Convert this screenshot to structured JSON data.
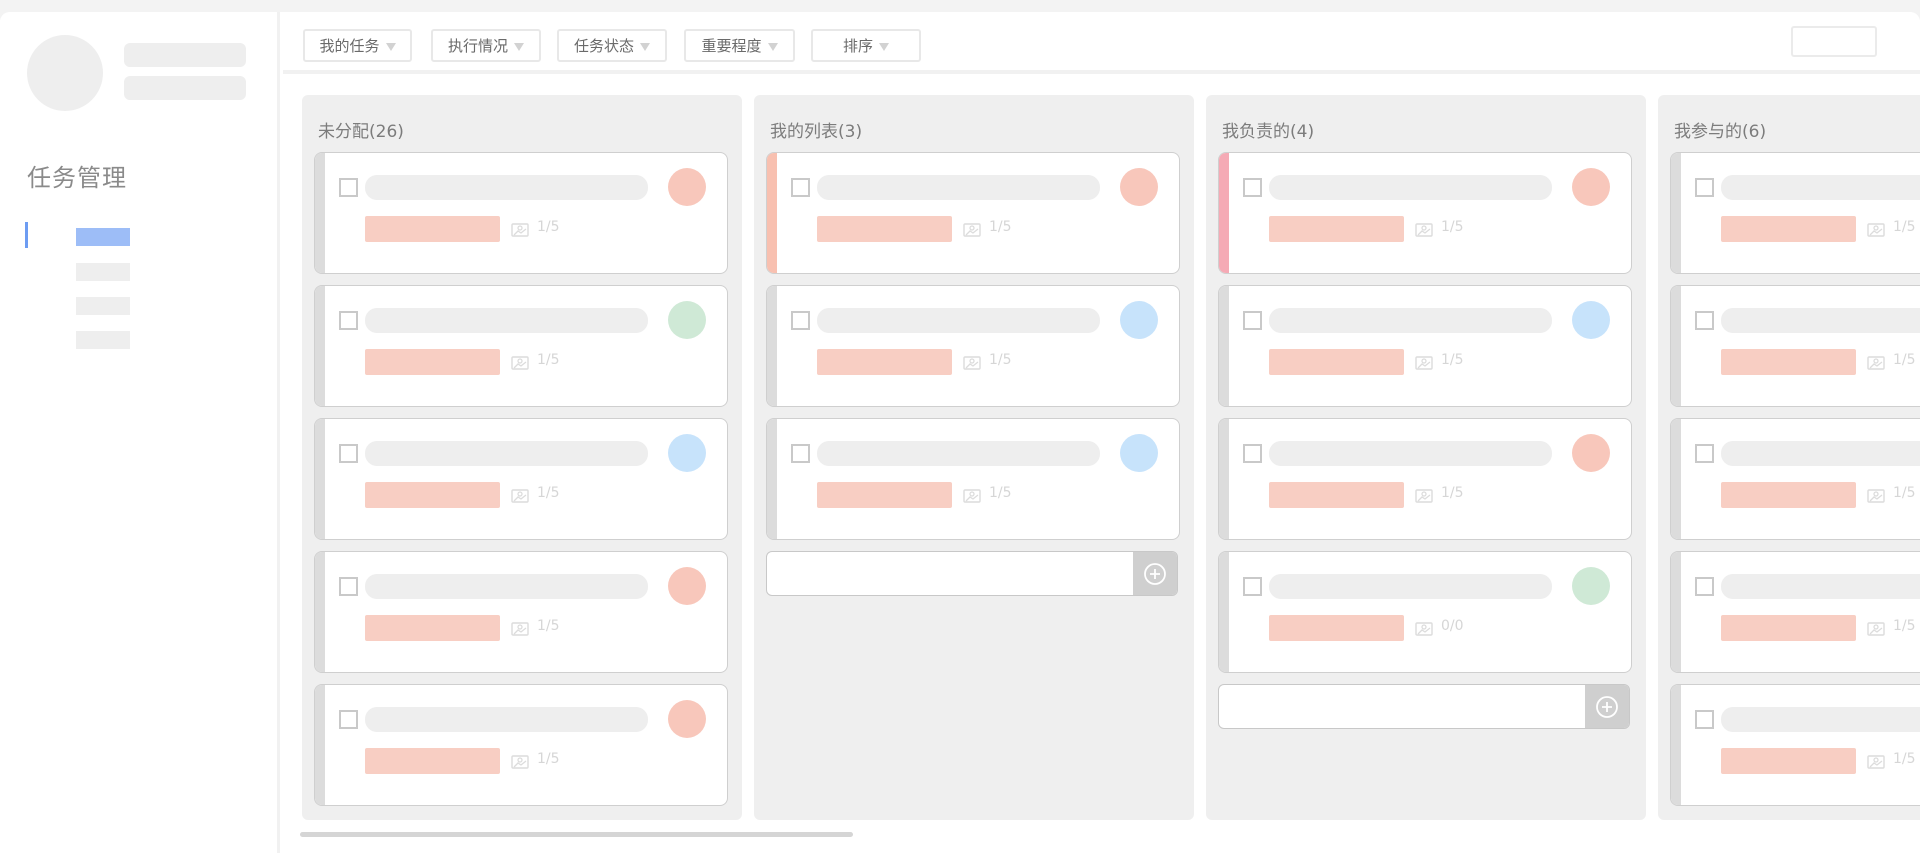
{
  "sidebar": {
    "title": "任务管理",
    "nav_items": [
      {
        "active": true
      },
      {
        "active": false
      },
      {
        "active": false
      },
      {
        "active": false
      }
    ]
  },
  "toolbar": {
    "filters": [
      {
        "label": "我的任务"
      },
      {
        "label": "执行情况"
      },
      {
        "label": "任务状态"
      },
      {
        "label": "重要程度"
      },
      {
        "label": "排序"
      }
    ]
  },
  "colors": {
    "avatar_red": "#f8c7bb",
    "avatar_green": "#cfe9d6",
    "avatar_blue": "#c7e3fb",
    "tag": "#f8cec3",
    "accent_orange": "#f8c0b0",
    "accent_pink": "#f5aab5",
    "nav_active": "#9dbdf7"
  },
  "columns": [
    {
      "title": "未分配(26)",
      "cards": [
        {
          "avatar": "red",
          "count": "1/5"
        },
        {
          "avatar": "green",
          "count": "1/5"
        },
        {
          "avatar": "blue",
          "count": "1/5"
        },
        {
          "avatar": "red",
          "count": "1/5"
        },
        {
          "avatar": "red",
          "count": "1/5"
        }
      ]
    },
    {
      "title": "我的列表(3)",
      "accent": "orange",
      "cards": [
        {
          "avatar": "red",
          "count": "1/5",
          "accent": true
        },
        {
          "avatar": "blue",
          "count": "1/5"
        },
        {
          "avatar": "blue",
          "count": "1/5"
        }
      ],
      "add_row": true
    },
    {
      "title": "我负责的(4)",
      "accent": "pink",
      "cards": [
        {
          "avatar": "red",
          "count": "1/5",
          "accent": true
        },
        {
          "avatar": "blue",
          "count": "1/5"
        },
        {
          "avatar": "red",
          "count": "1/5"
        },
        {
          "avatar": "green",
          "count": "0/0"
        }
      ],
      "add_row": true
    },
    {
      "title": "我参与的(6)",
      "cards": [
        {
          "avatar": "red",
          "count": "1/5"
        },
        {
          "avatar": "red",
          "count": "1/5"
        },
        {
          "avatar": "red",
          "count": "1/5"
        },
        {
          "avatar": "red",
          "count": "1/5"
        },
        {
          "avatar": "red",
          "count": "1/5"
        }
      ]
    }
  ]
}
